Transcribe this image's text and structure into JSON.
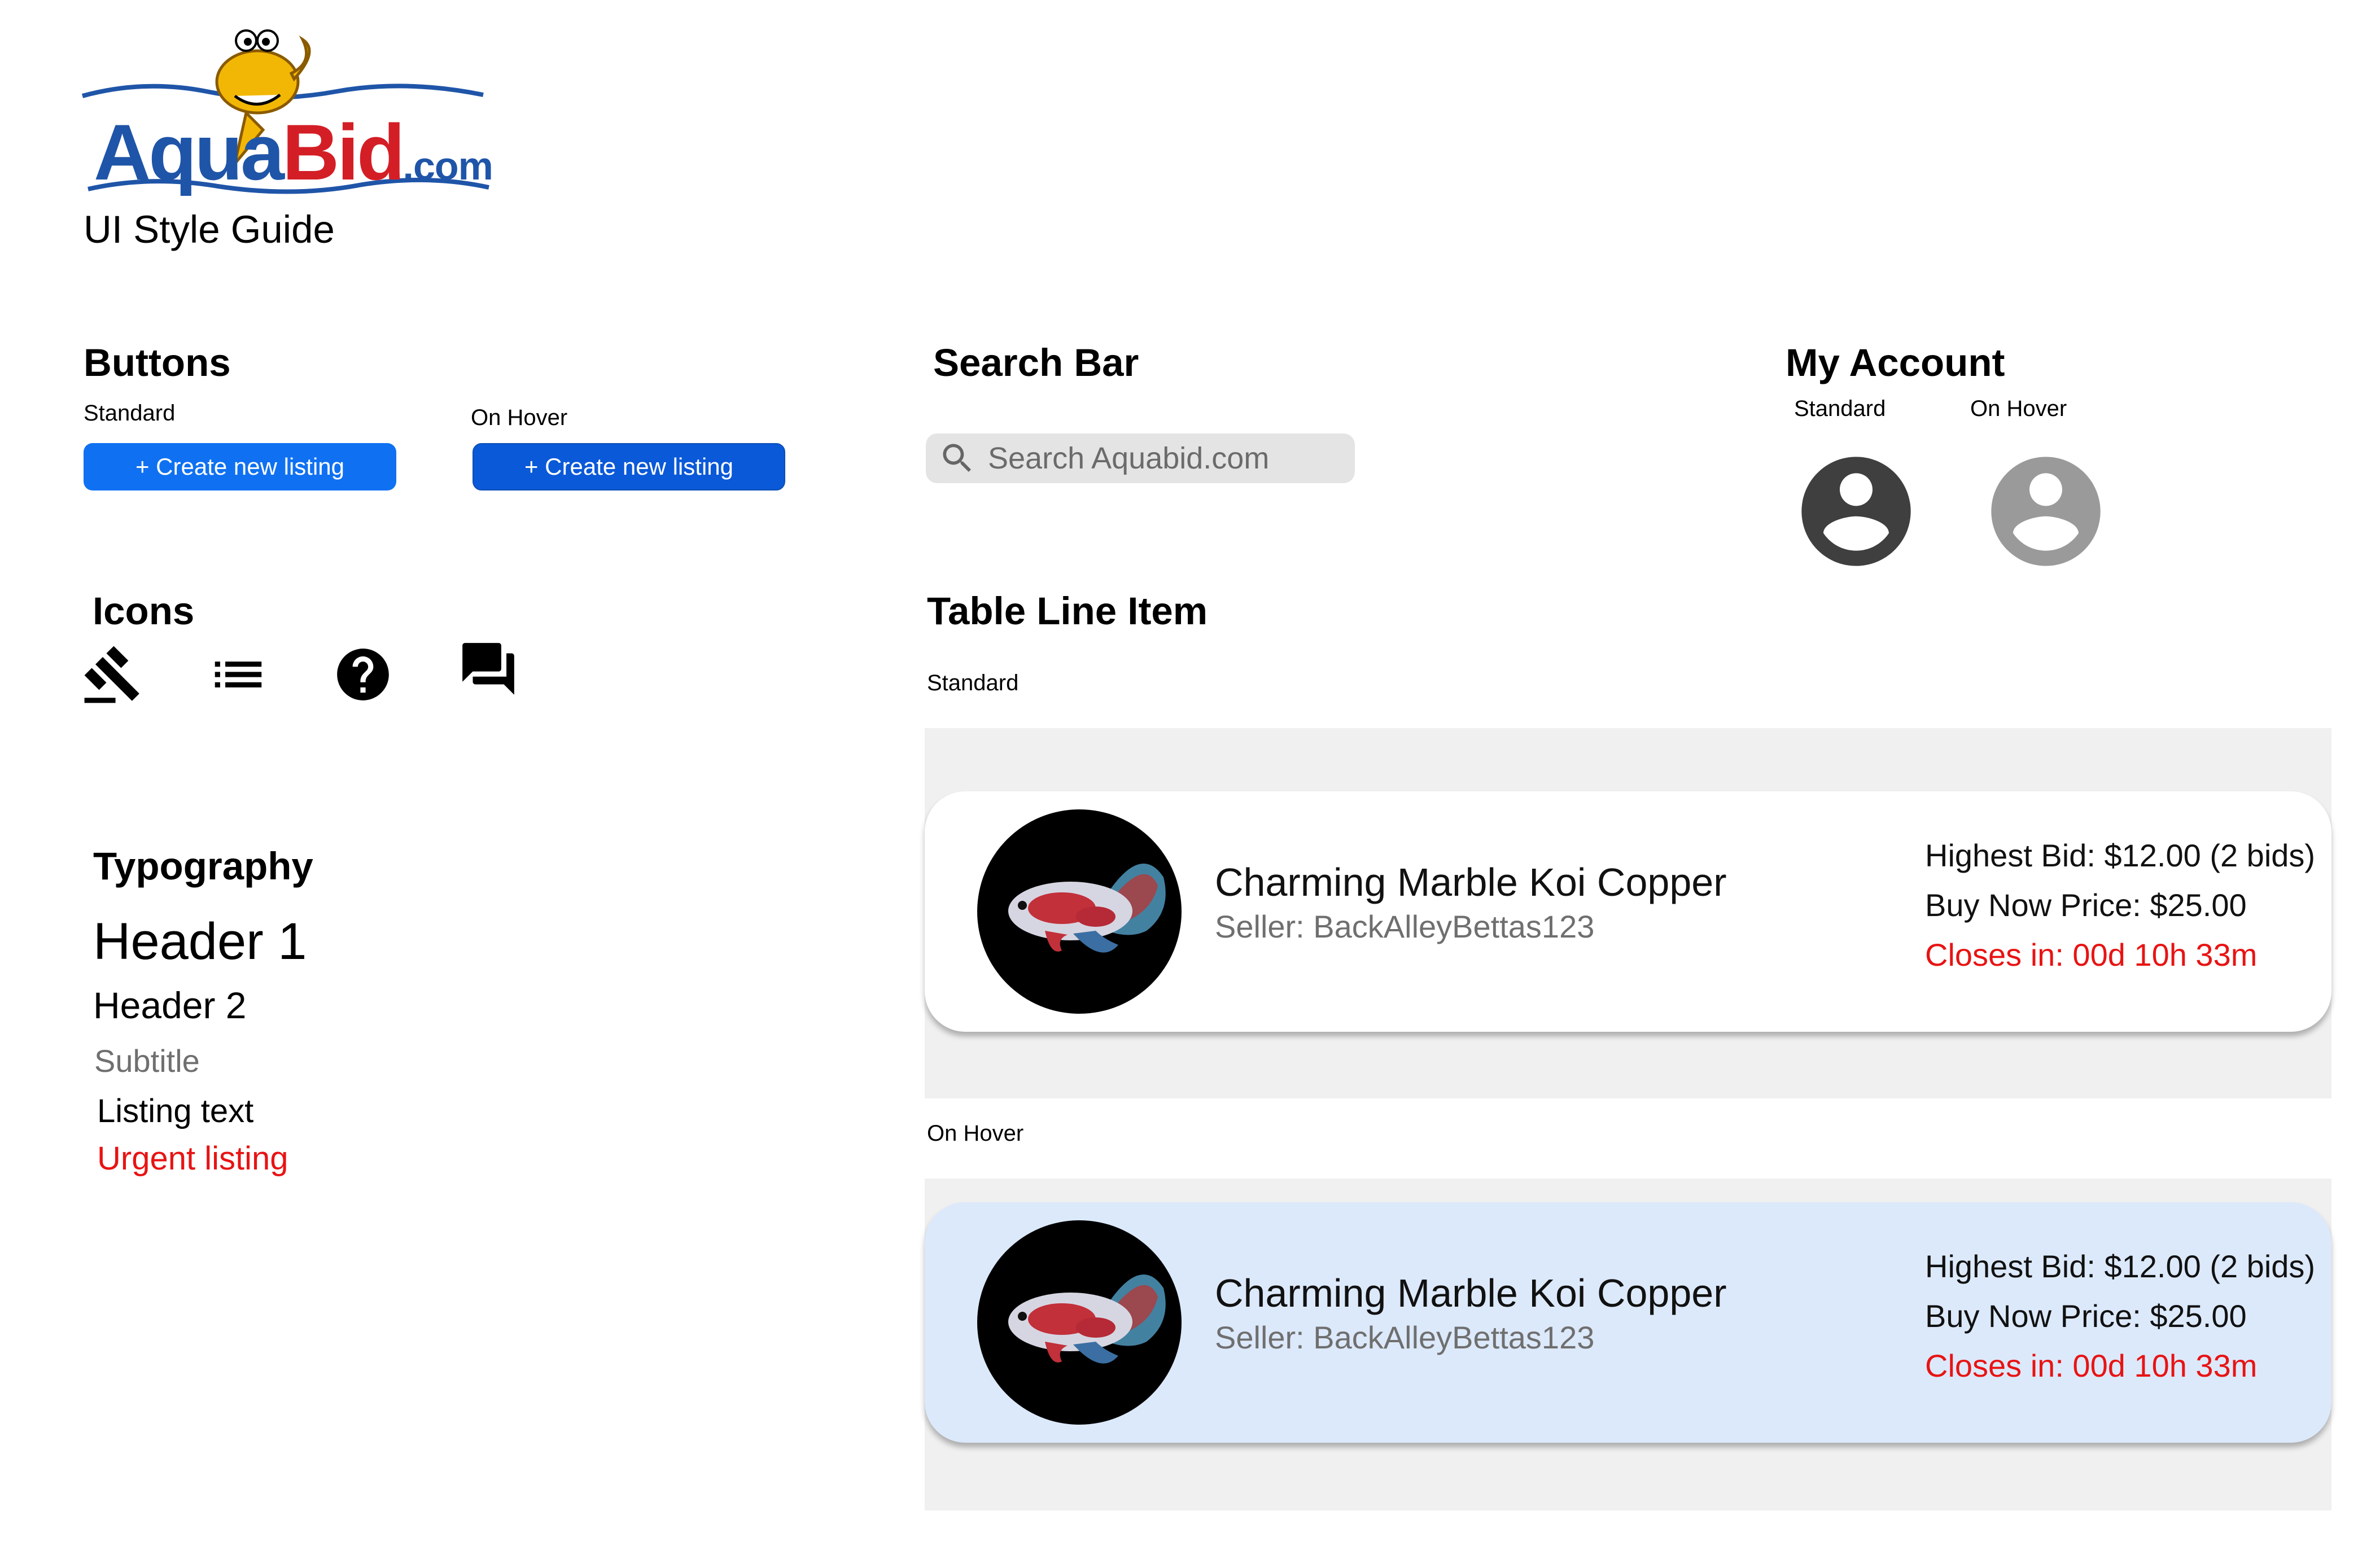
{
  "brand": {
    "logo_aqua": "Aqua",
    "logo_bid": "Bid",
    "logo_com": ".com",
    "doc_title": "UI Style Guide",
    "colors": {
      "blue": "#1f55a8",
      "red": "#d41e26",
      "fish": "#f2b705"
    }
  },
  "buttons": {
    "title": "Buttons",
    "standard_label": "Standard",
    "hover_label": "On Hover",
    "button_text": "+ Create new listing",
    "colors": {
      "standard": "#0f71f2",
      "hover": "#0a59d8"
    }
  },
  "search": {
    "title": "Search Bar",
    "placeholder": "Search Aquabid.com",
    "icon": "search-icon"
  },
  "account": {
    "title": "My Account",
    "standard_label": "Standard",
    "hover_label": "On Hover",
    "icon": "account-circle-icon",
    "colors": {
      "standard": "#3f3f3f",
      "hover": "#9a9a9a"
    }
  },
  "icons": {
    "title": "Icons",
    "items": [
      "gavel-icon",
      "list-icon",
      "help-icon",
      "forum-icon"
    ]
  },
  "typography": {
    "title": "Typography",
    "header1": "Header 1",
    "header2": "Header 2",
    "subtitle": "Subtitle",
    "listing_text": "Listing text",
    "urgent_listing": "Urgent listing",
    "colors": {
      "subtitle": "#6f6f6f",
      "urgent": "#e81313"
    }
  },
  "table": {
    "title": "Table Line Item",
    "standard_label": "Standard",
    "hover_label": "On Hover",
    "colors": {
      "standard_bg": "#ffffff",
      "hover_bg": "#dce9fb",
      "panel": "#f0f0f0"
    },
    "items": [
      {
        "title": "Charming Marble Koi Copper",
        "seller": "Seller: BackAlleyBettas123",
        "highest_bid": "Highest Bid: $12.00 (2 bids)",
        "buy_now": "Buy Now Price: $25.00",
        "closes": "Closes in: 00d 10h 33m"
      },
      {
        "title": "Charming Marble Koi Copper",
        "seller": "Seller: BackAlleyBettas123",
        "highest_bid": "Highest Bid: $12.00 (2 bids)",
        "buy_now": "Buy Now Price: $25.00",
        "closes": "Closes in: 00d 10h 33m"
      }
    ]
  }
}
